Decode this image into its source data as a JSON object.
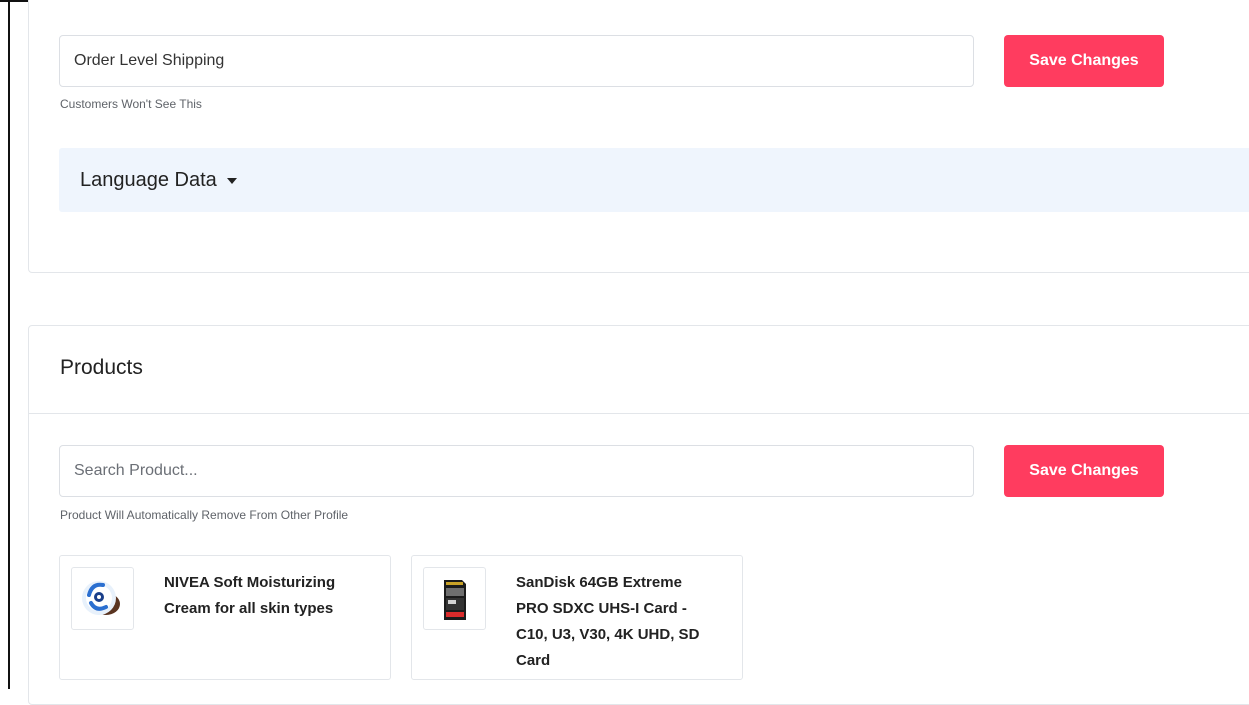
{
  "shipping_profile": {
    "name_value": "Order Level Shipping",
    "name_hint": "Customers Won't See This",
    "save_label": "Save Changes",
    "language_toggle_label": "Language Data"
  },
  "products_section": {
    "title": "Products",
    "search_placeholder": "Search Product...",
    "search_value": "",
    "search_hint": "Product Will Automatically Remove From Other Profile",
    "save_label": "Save Changes",
    "items": [
      {
        "name": "NIVEA Soft Moisturizing Cream for all skin types",
        "thumbnail_icon": "nivea-cream-jar-icon"
      },
      {
        "name": "SanDisk 64GB Extreme PRO SDXC UHS-I Card - C10, U3, V30, 4K UHD, SD Card",
        "thumbnail_icon": "sd-card-icon"
      }
    ]
  },
  "colors": {
    "accent": "#ff3c5f",
    "panel_bg": "#eff5fd",
    "border": "#e3e6ea"
  }
}
